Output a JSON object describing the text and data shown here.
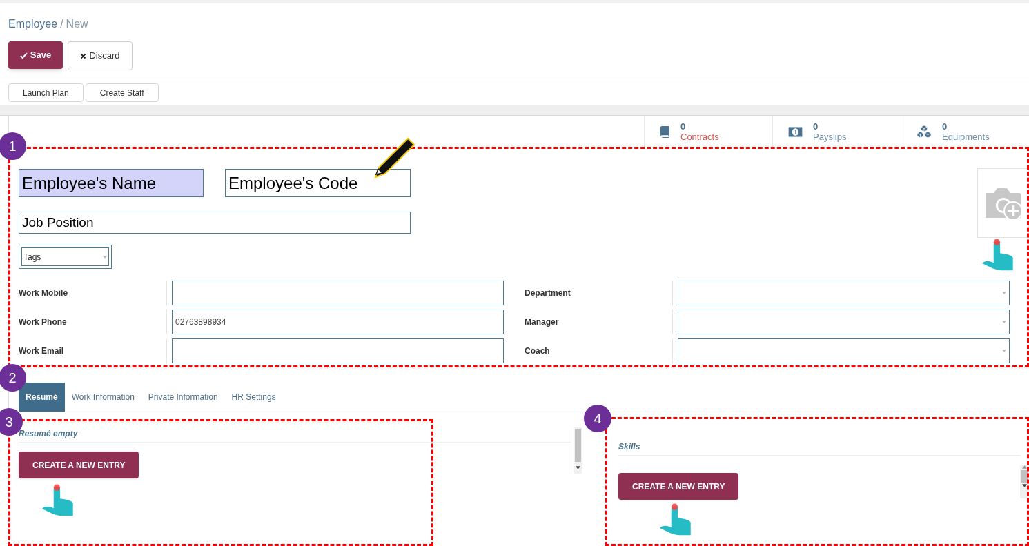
{
  "breadcrumb": {
    "parent": "Employee",
    "separator": "/",
    "current": "New"
  },
  "buttons": [
    {
      "kind": "primary",
      "label": "Save"
    },
    {
      "kind": "secondary",
      "label": "Discard"
    }
  ],
  "action_buttons": [
    "Launch Plan",
    "Create Staff"
  ],
  "stat_buttons": [
    {
      "kind": "book",
      "count": "0",
      "label": "Contracts",
      "highlighted": true
    },
    {
      "kind": "money",
      "count": "0",
      "label": "Payslips",
      "highlighted": false
    },
    {
      "kind": "boxes",
      "count": "0",
      "label": "Equipments",
      "highlighted": false
    }
  ],
  "name_field": {
    "placeholder": "Employee's Name",
    "focused": true
  },
  "code_field": {
    "placeholder": "Employee's Code",
    "focused": false
  },
  "job_field": {
    "placeholder": "Job Position"
  },
  "tags_field": {
    "placeholder": "Tags"
  },
  "left_fields": [
    {
      "label": "Work Mobile"
    },
    {
      "label": "Work Phone",
      "value": "02763898934"
    },
    {
      "label": "Work Email"
    }
  ],
  "right_fields": [
    {
      "label": "Department",
      "kind": "select"
    },
    {
      "label": "Manager",
      "kind": "select"
    },
    {
      "label": "Coach",
      "kind": "select"
    }
  ],
  "tabs": [
    {
      "label": "Resumé",
      "selected": true
    },
    {
      "label": "Work Information",
      "selected": false
    },
    {
      "label": "Private Information",
      "selected": false
    },
    {
      "label": "HR Settings",
      "selected": false
    }
  ],
  "resume": {
    "heading": "Resumé empty",
    "button": "CREATE A NEW ENTRY"
  },
  "skills": {
    "heading": "Skills",
    "button": "CREATE A NEW ENTRY"
  },
  "annotations": [
    {
      "label": "1"
    },
    {
      "label": "2"
    },
    {
      "label": "3"
    },
    {
      "label": "4"
    }
  ]
}
